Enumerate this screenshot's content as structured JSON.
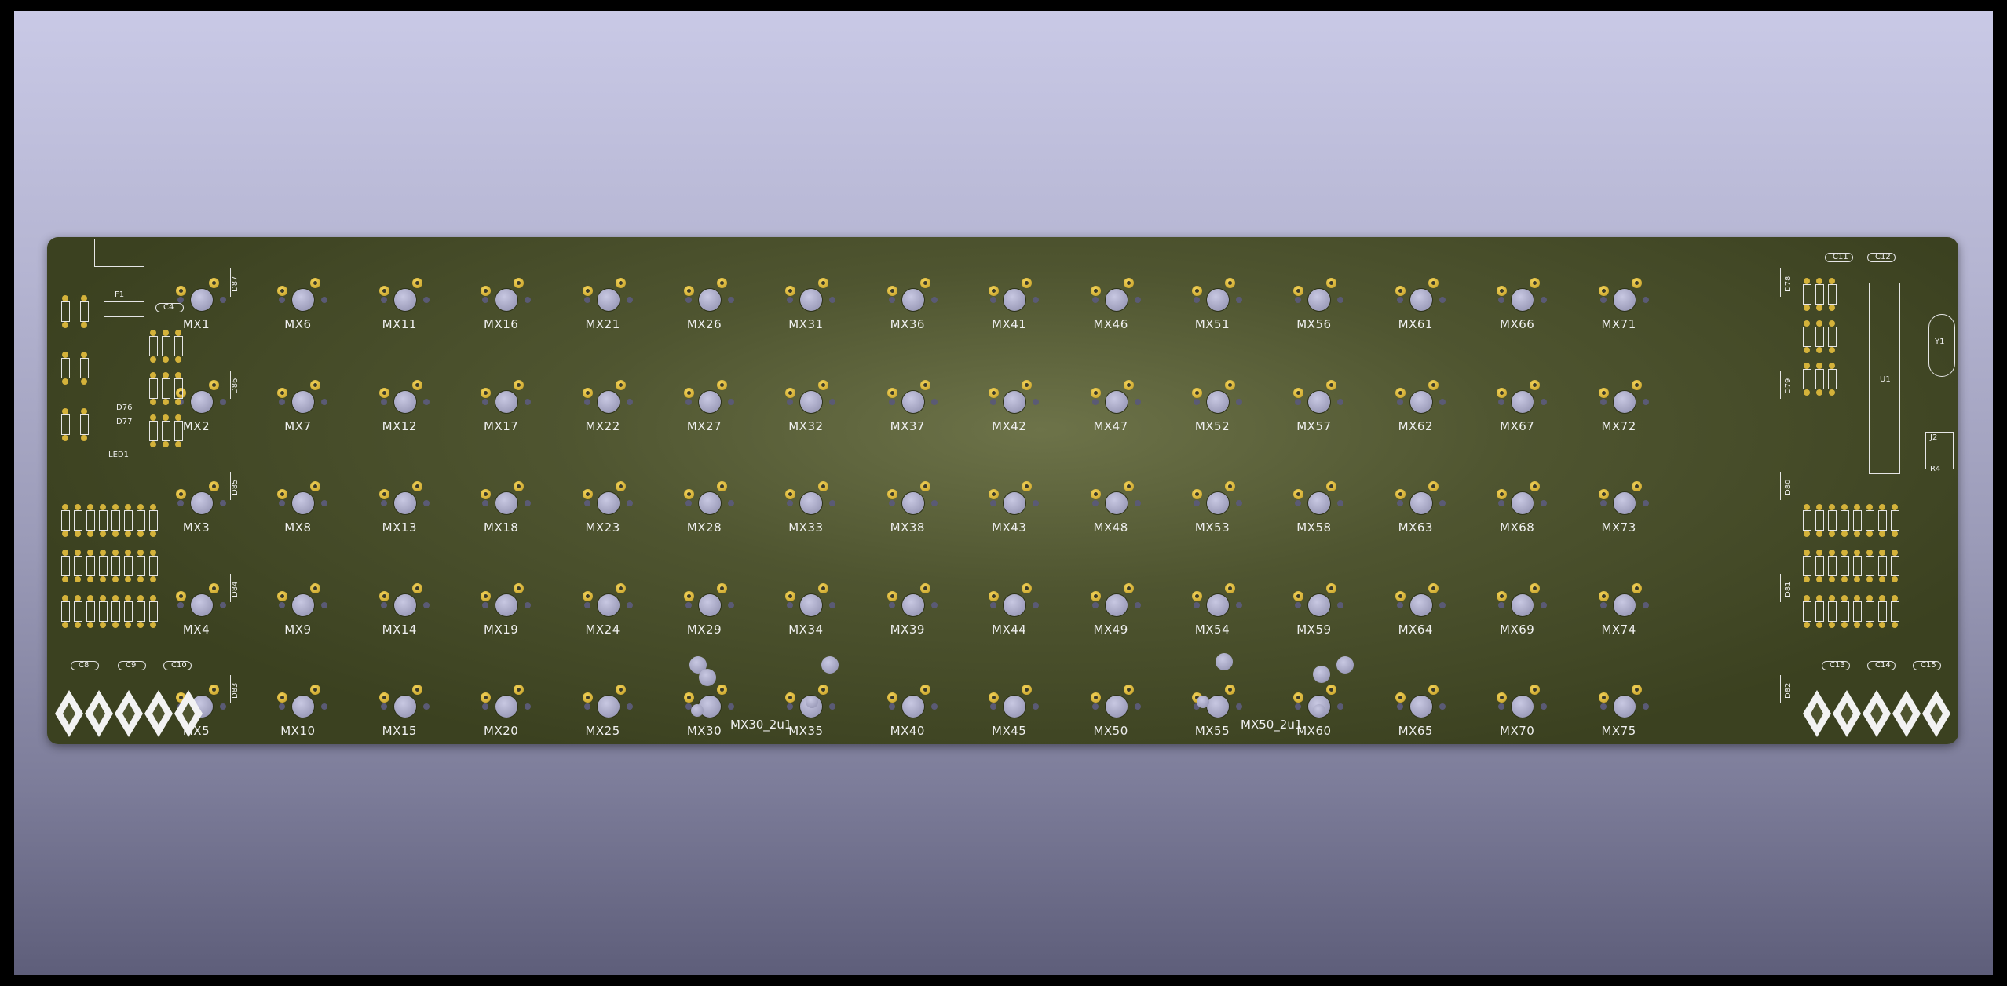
{
  "board": {
    "switch_rows": [
      [
        "MX1",
        "MX6",
        "MX11",
        "MX16",
        "MX21",
        "MX26",
        "MX31",
        "MX36",
        "MX41",
        "MX46",
        "MX51",
        "MX56",
        "MX61",
        "MX66",
        "MX71"
      ],
      [
        "MX2",
        "MX7",
        "MX12",
        "MX17",
        "MX22",
        "MX27",
        "MX32",
        "MX37",
        "MX42",
        "MX47",
        "MX52",
        "MX57",
        "MX62",
        "MX67",
        "MX72"
      ],
      [
        "MX3",
        "MX8",
        "MX13",
        "MX18",
        "MX23",
        "MX28",
        "MX33",
        "MX38",
        "MX43",
        "MX48",
        "MX53",
        "MX58",
        "MX63",
        "MX68",
        "MX73"
      ],
      [
        "MX4",
        "MX9",
        "MX14",
        "MX19",
        "MX24",
        "MX29",
        "MX34",
        "MX39",
        "MX44",
        "MX49",
        "MX54",
        "MX59",
        "MX64",
        "MX69",
        "MX74"
      ],
      [
        "MX5",
        "MX10",
        "MX15",
        "MX20",
        "MX25",
        "MX30",
        "MX35",
        "MX40",
        "MX45",
        "MX50",
        "MX55",
        "MX60",
        "MX65",
        "MX70",
        "MX75"
      ]
    ],
    "stab_labels": [
      "MX30_2u1",
      "MX50_2u1"
    ],
    "left_diodes": [
      "D87",
      "D86",
      "D85",
      "D84",
      "D83"
    ],
    "right_diodes": [
      "D78",
      "D79",
      "D80",
      "D81",
      "D82"
    ],
    "caps": {
      "c4": "C4",
      "c8": "C8",
      "c9": "C9",
      "c10": "C10",
      "c11": "C11",
      "c12": "C12",
      "c13": "C13",
      "c14": "C14",
      "c15": "C15"
    },
    "parts": {
      "f1": "F1",
      "u1": "U1",
      "y1": "Y1",
      "j2": "J2",
      "r4": "R4",
      "led": "LED1",
      "d76": "D76",
      "d77": "D77"
    },
    "colors": {
      "board": "#4f5530",
      "pad": "#d4b23a",
      "silk": "#f0f0f0",
      "hole": "#a5a5c3"
    }
  }
}
